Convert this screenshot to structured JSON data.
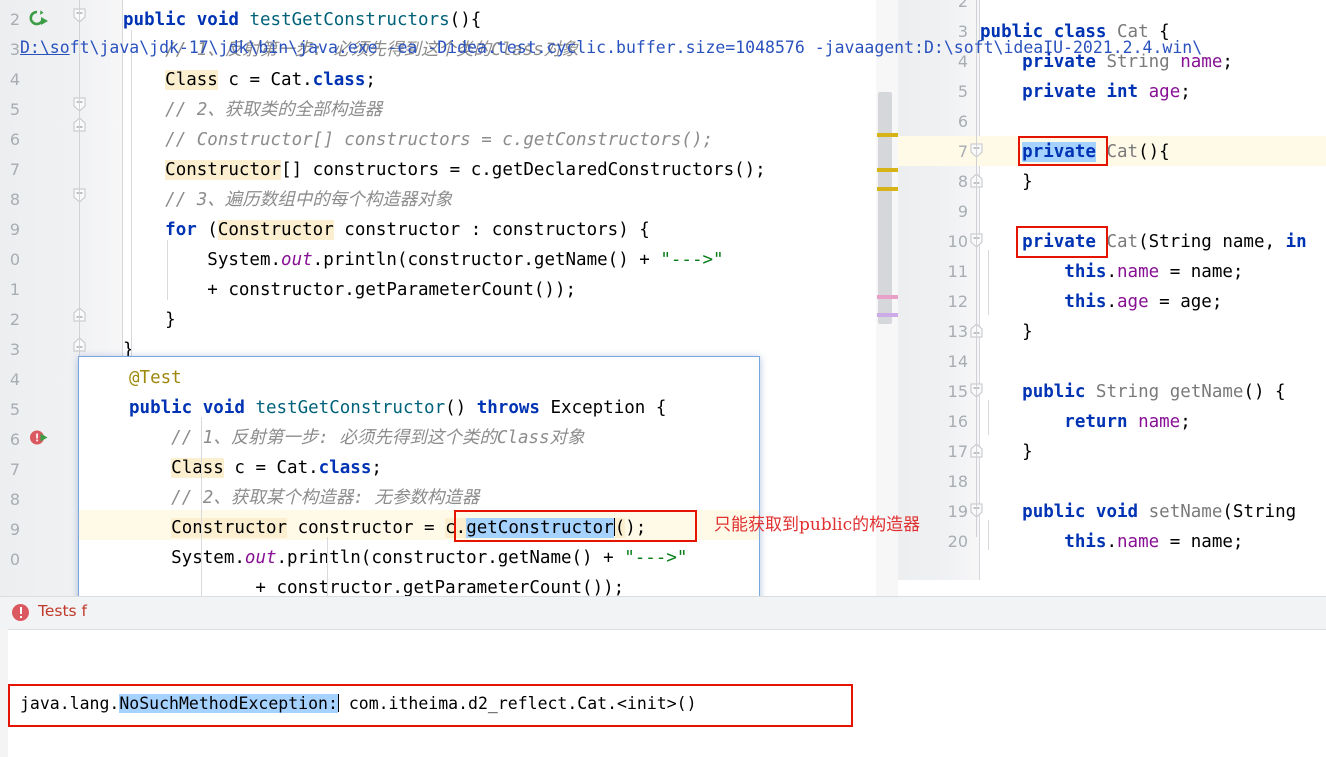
{
  "left_editor": {
    "line_numbers": [
      "2",
      "3",
      "4",
      "5",
      "6",
      "7",
      "8",
      "9",
      "0",
      "1",
      "2",
      "3",
      "4",
      "5",
      "6",
      "7",
      "8",
      "9",
      "0"
    ],
    "lines": [
      "public void testGetConstructors(){",
      "    // 1、反射第一步: 必须先得到这个类的Class对象",
      "    Class c = Cat.class;",
      "    // 2、获取类的全部构造器",
      "    // Constructor[] constructors = c.getConstructors();",
      "    Constructor[] constructors = c.getDeclaredConstructors();",
      "    // 3、遍历数组中的每个构造器对象",
      "    for (Constructor constructor : constructors) {",
      "        System.out.println(constructor.getName() + \"--->\"",
      "        + constructor.getParameterCount());",
      "    }",
      "}"
    ]
  },
  "popup_editor": {
    "lines": [
      "@Test",
      "public void testGetConstructor() throws Exception {",
      "    // 1、反射第一步: 必须先得到这个类的Class对象",
      "    Class c = Cat.class;",
      "    // 2、获取某个构造器: 无参数构造器",
      "    Constructor constructor = c.getConstructor();",
      "    System.out.println(constructor.getName() + \"--->\"",
      "            + constructor.getParameterCount());",
      "}"
    ],
    "selected_text": "c.getConstructor"
  },
  "annotation": {
    "text": "只能获取到public的构造器",
    "color": "#e03030"
  },
  "right_editor": {
    "line_numbers": [
      "2",
      "3",
      "4",
      "5",
      "6",
      "7",
      "8",
      "9",
      "10",
      "11",
      "12",
      "13",
      "14",
      "15",
      "16",
      "17",
      "18",
      "19",
      "20"
    ],
    "lines": [
      "",
      "public class Cat {",
      "    private String name;",
      "    private int age;",
      "",
      "    private Cat(){",
      "    }",
      "",
      "    private Cat(String name, in",
      "        this.name = name;",
      "        this.age = age;",
      "    }",
      "",
      "    public String getName() {",
      "        return name;",
      "    }",
      "",
      "    public void setName(String",
      "        this.name = name;"
    ],
    "highlighted_keywords": [
      "private",
      "private"
    ]
  },
  "console": {
    "tests_label": "Tests f",
    "command_line": "D:\\soft\\java\\jdk-17\\jdk\\bin\\java.exe  -ea  -Didea.test.cyclic.buffer.size=1048576 -javaagent:D:\\soft\\ideaIU-2021.2.4.win\\",
    "command_prefix_underlined": "D:\\so",
    "exception_prefix": "java.lang.",
    "exception_selected": "NoSuchMethodException:",
    "exception_suffix": " com.itheima.d2_reflect.Cat.<init>()"
  },
  "icons": {
    "run_test_ok": "run-success-icon",
    "run_test_fail": "run-error-icon",
    "error_badge": "error-badge-icon"
  },
  "colors": {
    "keyword": "#0033b3",
    "comment": "#8c8c8c",
    "string": "#067d17",
    "field": "#871094",
    "identifier_highlight": "#fbefd0",
    "selection": "#a6d2ff",
    "red_box": "#e51400",
    "annotation_red": "#e03030",
    "current_line": "#fffae8"
  }
}
